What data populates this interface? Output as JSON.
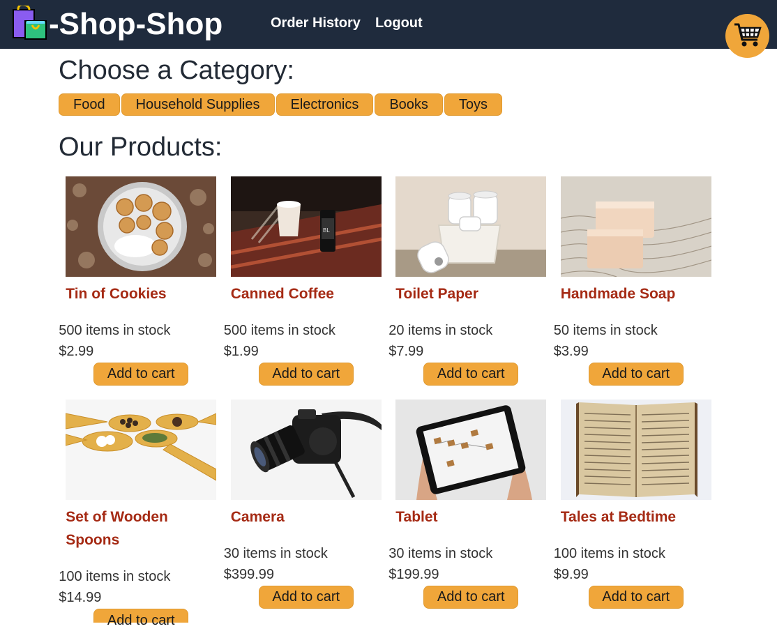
{
  "header": {
    "brand": "-Shop-Shop",
    "nav": [
      "Order History",
      "Logout"
    ]
  },
  "categories_title": "Choose a Category:",
  "categories": [
    "Food",
    "Household Supplies",
    "Electronics",
    "Books",
    "Toys"
  ],
  "products_title": "Our Products:",
  "add_label": "Add to cart",
  "products": [
    {
      "name": "Tin of Cookies",
      "stock": "500 items in stock",
      "price": "$2.99"
    },
    {
      "name": "Canned Coffee",
      "stock": "500 items in stock",
      "price": "$1.99"
    },
    {
      "name": "Toilet Paper",
      "stock": "20 items in stock",
      "price": "$7.99"
    },
    {
      "name": "Handmade Soap",
      "stock": "50 items in stock",
      "price": "$3.99"
    },
    {
      "name": "Set of Wooden Spoons",
      "stock": "100 items in stock",
      "price": "$14.99"
    },
    {
      "name": "Camera",
      "stock": "30 items in stock",
      "price": "$399.99"
    },
    {
      "name": "Tablet",
      "stock": "30 items in stock",
      "price": "$199.99"
    },
    {
      "name": "Tales at Bedtime",
      "stock": "100 items in stock",
      "price": "$9.99"
    }
  ],
  "colors": {
    "header_bg": "#1f2b3d",
    "accent": "#f0a63a",
    "product_name": "#a52a14"
  },
  "icons": {
    "logo": "shopping-bags-icon",
    "cart": "shopping-cart-icon"
  }
}
